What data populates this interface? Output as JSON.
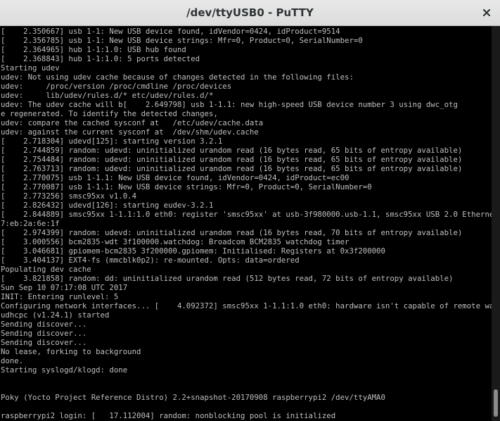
{
  "window": {
    "title": "/dev/ttyUSB0 - PuTTY"
  },
  "icons": {
    "close": "close-icon"
  },
  "terminal": {
    "fg_color": "#bfbfbf",
    "bg_color": "#000000",
    "cursor_color": "#00ff00",
    "lines": [
      "[    2.350667] usb 1-1: New USB device found, idVendor=0424, idProduct=9514",
      "[    2.356785] usb 1-1: New USB device strings: Mfr=0, Product=0, SerialNumber=0",
      "[    2.364965] hub 1-1:1.0: USB hub found",
      "[    2.368843] hub 1-1:1.0: 5 ports detected",
      "Starting udev",
      "udev: Not using udev cache because of changes detected in the following files:",
      "udev:     /proc/version /proc/cmdline /proc/devices",
      "udev:     lib/udev/rules.d/* etc/udev/rules.d/*",
      "udev: The udev cache will b[    2.649798] usb 1-1.1: new high-speed USB device number 3 using dwc_otg",
      "e regenerated. To identify the detected changes,",
      "udev: compare the cached sysconf at   /etc/udev/cache.data",
      "udev: against the current sysconf at  /dev/shm/udev.cache",
      "[    2.718304] udevd[125]: starting version 3.2.1",
      "[    2.744859] random: udevd: uninitialized urandom read (16 bytes read, 65 bits of entropy available)",
      "[    2.754484] random: udevd: uninitialized urandom read (16 bytes read, 65 bits of entropy available)",
      "[    2.763713] random: udevd: uninitialized urandom read (16 bytes read, 65 bits of entropy available)",
      "[    2.770075] usb 1-1.1: New USB device found, idVendor=0424, idProduct=ec00",
      "[    2.770087] usb 1-1.1: New USB device strings: Mfr=0, Product=0, SerialNumber=0",
      "[    2.773256] smsc95xx v1.0.4",
      "[    2.826432] udevd[126]: starting eudev-3.2.1",
      "[    2.844889] smsc95xx 1-1.1:1.0 eth0: register 'smsc95xx' at usb-3f980000.usb-1.1, smsc95xx USB 2.0 Ethernet, b8:2",
      "7:eb:2a:6e:1f",
      "[    2.974399] random: udevd: uninitialized urandom read (16 bytes read, 70 bits of entropy available)",
      "[    3.000556] bcm2835-wdt 3f100000.watchdog: Broadcom BCM2835 watchdog timer",
      "[    3.046681] gpiomem-bcm2835 3f200000.gpiomem: Initialised: Registers at 0x3f200000",
      "[    3.404137] EXT4-fs (mmcblk0p2): re-mounted. Opts: data=ordered",
      "Populating dev cache",
      "[    3.821858] random: dd: uninitialized urandom read (512 bytes read, 72 bits of entropy available)",
      "Sun Sep 10 07:17:08 UTC 2017",
      "INIT: Entering runlevel: 5",
      "Configuring network interfaces... [    4.092372] smsc95xx 1-1.1:1.0 eth0: hardware isn't capable of remote wakeup",
      "udhcpc (v1.24.1) started",
      "Sending discover...",
      "Sending discover...",
      "Sending discover...",
      "No lease, forking to background",
      "done.",
      "Starting syslogd/klogd: done",
      "",
      "",
      "Poky (Yocto Project Reference Distro) 2.2+snapshot-20170908 raspberrypi2 /dev/ttyAMA0",
      "",
      "raspberrypi2 login: [   17.112004] random: nonblocking pool is initialized"
    ]
  },
  "scrollbar": {
    "thumb_start_fraction": 0.92,
    "thumb_end_fraction": 0.99
  }
}
